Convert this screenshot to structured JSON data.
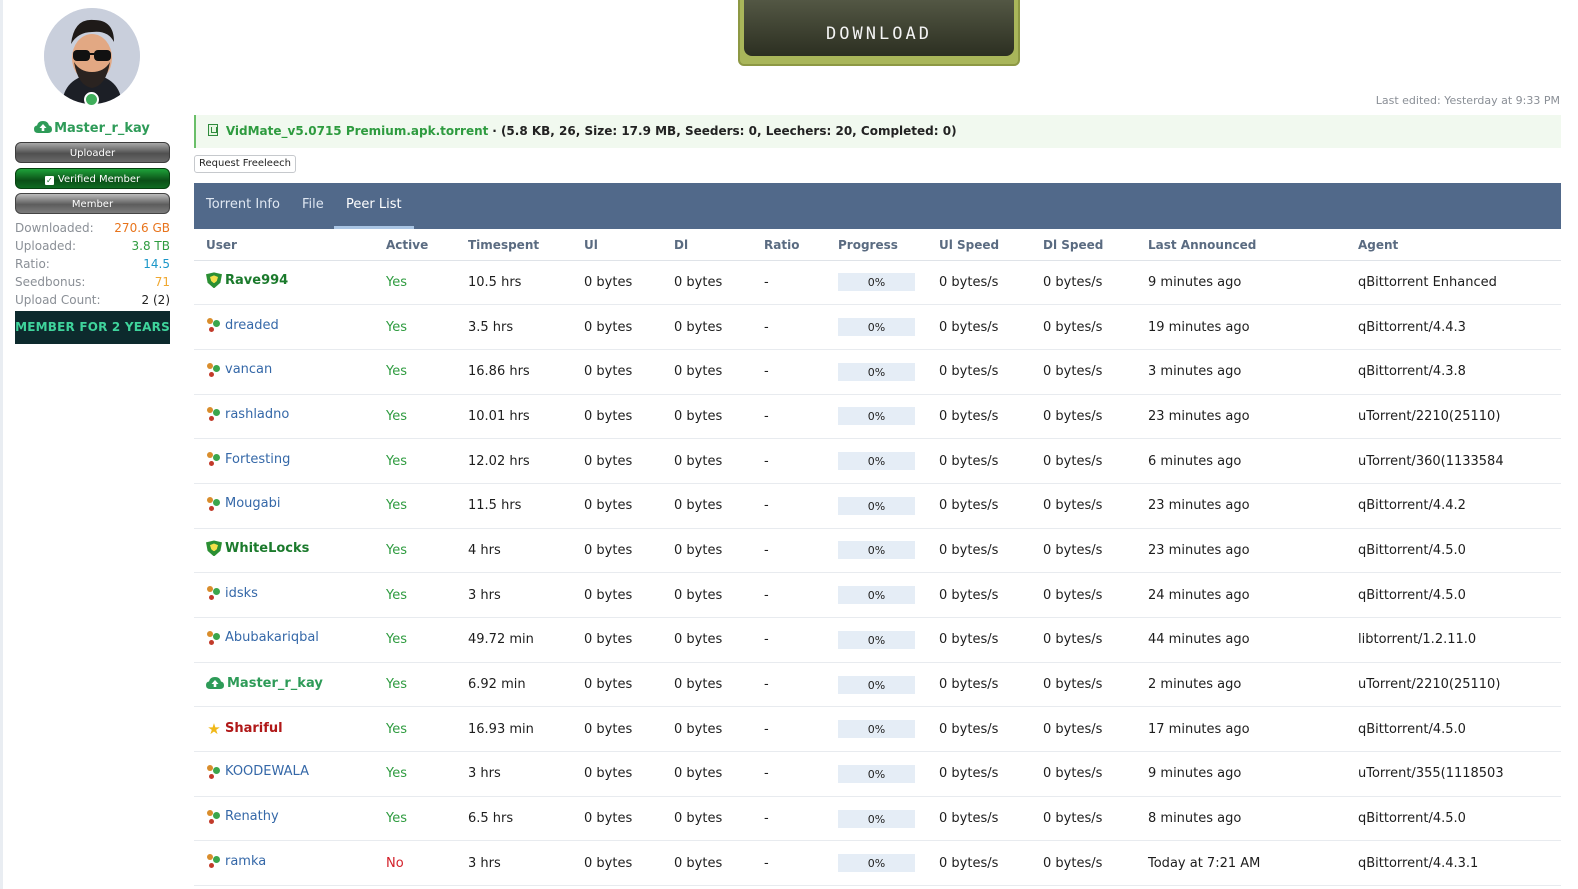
{
  "banner": {
    "text": "DOWNLOAD"
  },
  "profile": {
    "username": "Master_r_kay",
    "badges": {
      "uploader": "Uploader",
      "verified": "Verified Member",
      "member": "Member"
    },
    "stats": [
      {
        "label": "Downloaded:",
        "value": "270.6 GB",
        "color": "#e8741c"
      },
      {
        "label": "Uploaded:",
        "value": "3.8 TB",
        "color": "#2e9b3f"
      },
      {
        "label": "Ratio:",
        "value": "14.5",
        "color": "#1a96c8"
      },
      {
        "label": "Seedbonus:",
        "value": "71",
        "color": "#f0a830"
      },
      {
        "label": "Upload Count:",
        "value": "2 (2)",
        "color": "#222222"
      }
    ],
    "member_for": "MEMBER FOR 2 YEARS"
  },
  "last_edited": "Last edited: Yesterday at 9:33 PM",
  "attachment": {
    "filename": "VidMate_v5.0715 Premium.apk.torrent",
    "meta": "· (5.8 KB, 26, Size: 17.9 MB, Seeders: 0, Leechers: 20, Completed: 0)"
  },
  "request_freeleech": "Request Freeleech",
  "tabs": [
    {
      "label": "Torrent Info"
    },
    {
      "label": "File"
    },
    {
      "label": "Peer List",
      "active": true
    }
  ],
  "columns": [
    "User",
    "Active",
    "Timespent",
    "Ul",
    "Dl",
    "Ratio",
    "Progress",
    "Ul Speed",
    "Dl Speed",
    "Last Announced",
    "Agent"
  ],
  "peers": [
    {
      "user": "Rave994",
      "icon": "shield",
      "style": "staff",
      "active": "Yes",
      "timespent": "10.5 hrs",
      "ul": "0 bytes",
      "dl": "0 bytes",
      "ratio": "-",
      "progress": "0%",
      "ul_speed": "0 bytes/s",
      "dl_speed": "0 bytes/s",
      "last_announced": "9 minutes ago",
      "agent": "qBittorrent Enhanced"
    },
    {
      "user": "dreaded",
      "icon": "people",
      "style": "normal",
      "active": "Yes",
      "timespent": "3.5 hrs",
      "ul": "0 bytes",
      "dl": "0 bytes",
      "ratio": "-",
      "progress": "0%",
      "ul_speed": "0 bytes/s",
      "dl_speed": "0 bytes/s",
      "last_announced": "19 minutes ago",
      "agent": "qBittorrent/4.4.3"
    },
    {
      "user": "vancan",
      "icon": "people",
      "style": "normal",
      "active": "Yes",
      "timespent": "16.86 hrs",
      "ul": "0 bytes",
      "dl": "0 bytes",
      "ratio": "-",
      "progress": "0%",
      "ul_speed": "0 bytes/s",
      "dl_speed": "0 bytes/s",
      "last_announced": "3 minutes ago",
      "agent": "qBittorrent/4.3.8"
    },
    {
      "user": "rashladno",
      "icon": "people",
      "style": "normal",
      "active": "Yes",
      "timespent": "10.01 hrs",
      "ul": "0 bytes",
      "dl": "0 bytes",
      "ratio": "-",
      "progress": "0%",
      "ul_speed": "0 bytes/s",
      "dl_speed": "0 bytes/s",
      "last_announced": "23 minutes ago",
      "agent": "uTorrent/2210(25110)"
    },
    {
      "user": "Fortesting",
      "icon": "people",
      "style": "normal",
      "active": "Yes",
      "timespent": "12.02 hrs",
      "ul": "0 bytes",
      "dl": "0 bytes",
      "ratio": "-",
      "progress": "0%",
      "ul_speed": "0 bytes/s",
      "dl_speed": "0 bytes/s",
      "last_announced": "6 minutes ago",
      "agent": "uTorrent/360(1133584"
    },
    {
      "user": "Mougabi",
      "icon": "people",
      "style": "normal",
      "active": "Yes",
      "timespent": "11.5 hrs",
      "ul": "0 bytes",
      "dl": "0 bytes",
      "ratio": "-",
      "progress": "0%",
      "ul_speed": "0 bytes/s",
      "dl_speed": "0 bytes/s",
      "last_announced": "23 minutes ago",
      "agent": "qBittorrent/4.4.2"
    },
    {
      "user": "WhiteLocks",
      "icon": "shield",
      "style": "staff",
      "active": "Yes",
      "timespent": "4 hrs",
      "ul": "0 bytes",
      "dl": "0 bytes",
      "ratio": "-",
      "progress": "0%",
      "ul_speed": "0 bytes/s",
      "dl_speed": "0 bytes/s",
      "last_announced": "23 minutes ago",
      "agent": "qBittorrent/4.5.0"
    },
    {
      "user": "idsks",
      "icon": "people",
      "style": "normal",
      "active": "Yes",
      "timespent": "3 hrs",
      "ul": "0 bytes",
      "dl": "0 bytes",
      "ratio": "-",
      "progress": "0%",
      "ul_speed": "0 bytes/s",
      "dl_speed": "0 bytes/s",
      "last_announced": "24 minutes ago",
      "agent": "qBittorrent/4.5.0"
    },
    {
      "user": "Abubakariqbal",
      "icon": "people",
      "style": "normal",
      "active": "Yes",
      "timespent": "49.72 min",
      "ul": "0 bytes",
      "dl": "0 bytes",
      "ratio": "-",
      "progress": "0%",
      "ul_speed": "0 bytes/s",
      "dl_speed": "0 bytes/s",
      "last_announced": "44 minutes ago",
      "agent": "libtorrent/1.2.11.0"
    },
    {
      "user": "Master_r_kay",
      "icon": "cloud",
      "style": "uploader",
      "active": "Yes",
      "timespent": "6.92 min",
      "ul": "0 bytes",
      "dl": "0 bytes",
      "ratio": "-",
      "progress": "0%",
      "ul_speed": "0 bytes/s",
      "dl_speed": "0 bytes/s",
      "last_announced": "2 minutes ago",
      "agent": "uTorrent/2210(25110)"
    },
    {
      "user": "Shariful",
      "icon": "star",
      "style": "vip",
      "active": "Yes",
      "timespent": "16.93 min",
      "ul": "0 bytes",
      "dl": "0 bytes",
      "ratio": "-",
      "progress": "0%",
      "ul_speed": "0 bytes/s",
      "dl_speed": "0 bytes/s",
      "last_announced": "17 minutes ago",
      "agent": "qBittorrent/4.5.0"
    },
    {
      "user": "KOODEWALA",
      "icon": "people",
      "style": "normal",
      "active": "Yes",
      "timespent": "3 hrs",
      "ul": "0 bytes",
      "dl": "0 bytes",
      "ratio": "-",
      "progress": "0%",
      "ul_speed": "0 bytes/s",
      "dl_speed": "0 bytes/s",
      "last_announced": "9 minutes ago",
      "agent": "uTorrent/355(1118503"
    },
    {
      "user": "Renathy",
      "icon": "people",
      "style": "normal",
      "active": "Yes",
      "timespent": "6.5 hrs",
      "ul": "0 bytes",
      "dl": "0 bytes",
      "ratio": "-",
      "progress": "0%",
      "ul_speed": "0 bytes/s",
      "dl_speed": "0 bytes/s",
      "last_announced": "8 minutes ago",
      "agent": "qBittorrent/4.5.0"
    },
    {
      "user": "ramka",
      "icon": "people",
      "style": "normal",
      "active": "No",
      "timespent": "3 hrs",
      "ul": "0 bytes",
      "dl": "0 bytes",
      "ratio": "-",
      "progress": "0%",
      "ul_speed": "0 bytes/s",
      "dl_speed": "0 bytes/s",
      "last_announced": "Today at 7:21 AM",
      "agent": "qBittorrent/4.4.3.1"
    }
  ]
}
